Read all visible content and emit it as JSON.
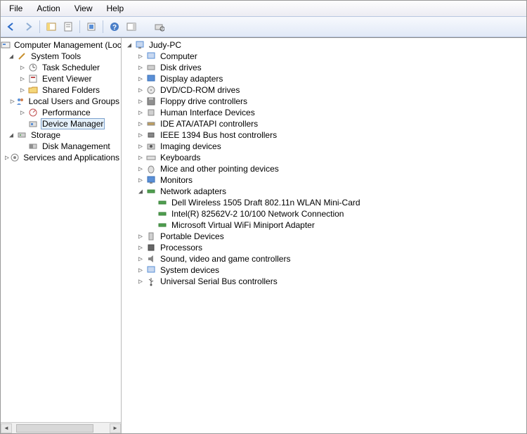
{
  "menu": {
    "file": "File",
    "action": "Action",
    "view": "View",
    "help": "Help"
  },
  "left_tree": {
    "root": "Computer Management (Local",
    "system_tools": "System Tools",
    "task_scheduler": "Task Scheduler",
    "event_viewer": "Event Viewer",
    "shared_folders": "Shared Folders",
    "local_users_groups": "Local Users and Groups",
    "performance": "Performance",
    "device_manager": "Device Manager",
    "storage": "Storage",
    "disk_management": "Disk Management",
    "services_apps": "Services and Applications"
  },
  "right_tree": {
    "root": "Judy-PC",
    "computer": "Computer",
    "disk_drives": "Disk drives",
    "display_adapters": "Display adapters",
    "dvd_cd": "DVD/CD-ROM drives",
    "floppy": "Floppy drive controllers",
    "hid": "Human Interface Devices",
    "ide": "IDE ATA/ATAPI controllers",
    "ieee1394": "IEEE 1394 Bus host controllers",
    "imaging": "Imaging devices",
    "keyboards": "Keyboards",
    "mice": "Mice and other pointing devices",
    "monitors": "Monitors",
    "network": "Network adapters",
    "net1": "Dell Wireless 1505 Draft 802.11n WLAN Mini-Card",
    "net2": "Intel(R) 82562V-2 10/100 Network Connection",
    "net3": "Microsoft Virtual WiFi Miniport Adapter",
    "portable": "Portable Devices",
    "processors": "Processors",
    "sound": "Sound, video and game controllers",
    "system_devices": "System devices",
    "usb": "Universal Serial Bus controllers"
  }
}
